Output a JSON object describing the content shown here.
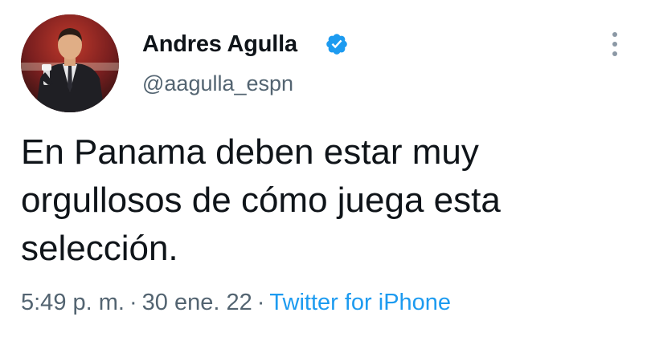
{
  "tweet": {
    "author": {
      "display_name": "Andres Agulla",
      "handle": "@aagulla_espn",
      "verified": true,
      "verified_icon": "verified-badge-icon",
      "avatar": "avatar-photo"
    },
    "text_lines": [
      "En Panama deben estar muy",
      "orgullosos de cómo juega esta",
      "selección."
    ],
    "time": "5:49 p. m.",
    "separator": "·",
    "date": "30 ene. 22",
    "source": "Twitter for iPhone",
    "more_icon": "more-vertical-icon"
  },
  "colors": {
    "text": "#0f1419",
    "secondary": "#536471",
    "accent": "#1d9bf0",
    "more_dots": "#8b98a5"
  }
}
